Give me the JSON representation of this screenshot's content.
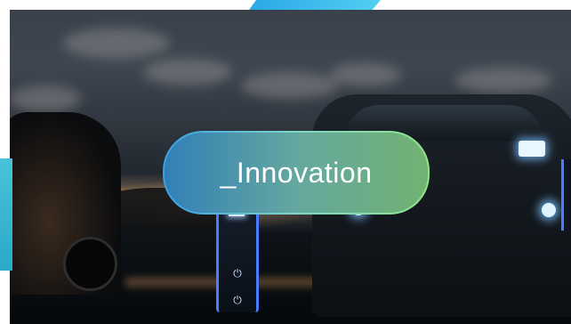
{
  "hero": {
    "headline": "_Innovation",
    "colors": {
      "accent_blue": "#2aa7e6",
      "accent_cyan": "#49c3d9",
      "gradient_start": "#3aa0e8",
      "gradient_end": "#92e48a",
      "charger_blue": "#4a7cff"
    },
    "icons": [
      "ev-plug-icon"
    ]
  }
}
